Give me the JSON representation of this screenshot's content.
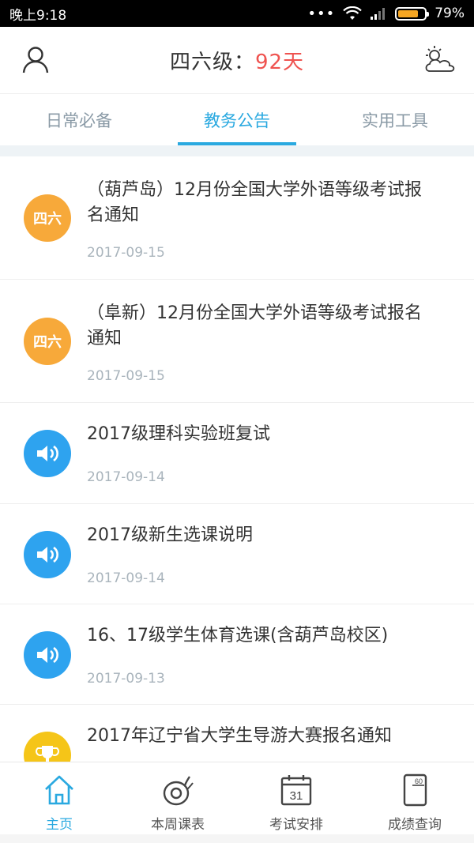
{
  "statusbar": {
    "time": "晚上9:18",
    "battery": "79%",
    "battery_level": 0.79
  },
  "header": {
    "title_prefix": "四六级：",
    "days": "92天"
  },
  "tabs": [
    {
      "label": "日常必备",
      "active": false
    },
    {
      "label": "教务公告",
      "active": true
    },
    {
      "label": "实用工具",
      "active": false
    }
  ],
  "list": [
    {
      "icon": "cet-badge",
      "badge": "四六",
      "title": "（葫芦岛）12月份全国大学外语等级考试报名通知",
      "date": "2017-09-15"
    },
    {
      "icon": "cet-badge",
      "badge": "四六",
      "title": "（阜新）12月份全国大学外语等级考试报名通知",
      "date": "2017-09-15"
    },
    {
      "icon": "speaker-icon",
      "badge": "",
      "title": "2017级理科实验班复试",
      "date": "2017-09-14"
    },
    {
      "icon": "speaker-icon",
      "badge": "",
      "title": "2017级新生选课说明",
      "date": "2017-09-14"
    },
    {
      "icon": "speaker-icon",
      "badge": "",
      "title": "16、17级学生体育选课(含葫芦岛校区)",
      "date": "2017-09-13"
    },
    {
      "icon": "trophy-icon",
      "badge": "",
      "title": "2017年辽宁省大学生导游大赛报名通知",
      "date": ""
    }
  ],
  "bottomnav": [
    {
      "label": "主页",
      "icon": "home-icon",
      "active": true
    },
    {
      "label": "本周课表",
      "icon": "schedule-icon",
      "active": false
    },
    {
      "label": "考试安排",
      "icon": "calendar-icon",
      "active": false,
      "calendar_day": "31"
    },
    {
      "label": "成绩查询",
      "icon": "score-card-icon",
      "active": false,
      "card_text": "60"
    }
  ],
  "colors": {
    "accent": "#2aa9e0",
    "days": "#ef5350",
    "cet_badge": "#f7a93a",
    "notice_badge": "#2ea3ef",
    "trophy_badge": "#f5c518"
  }
}
